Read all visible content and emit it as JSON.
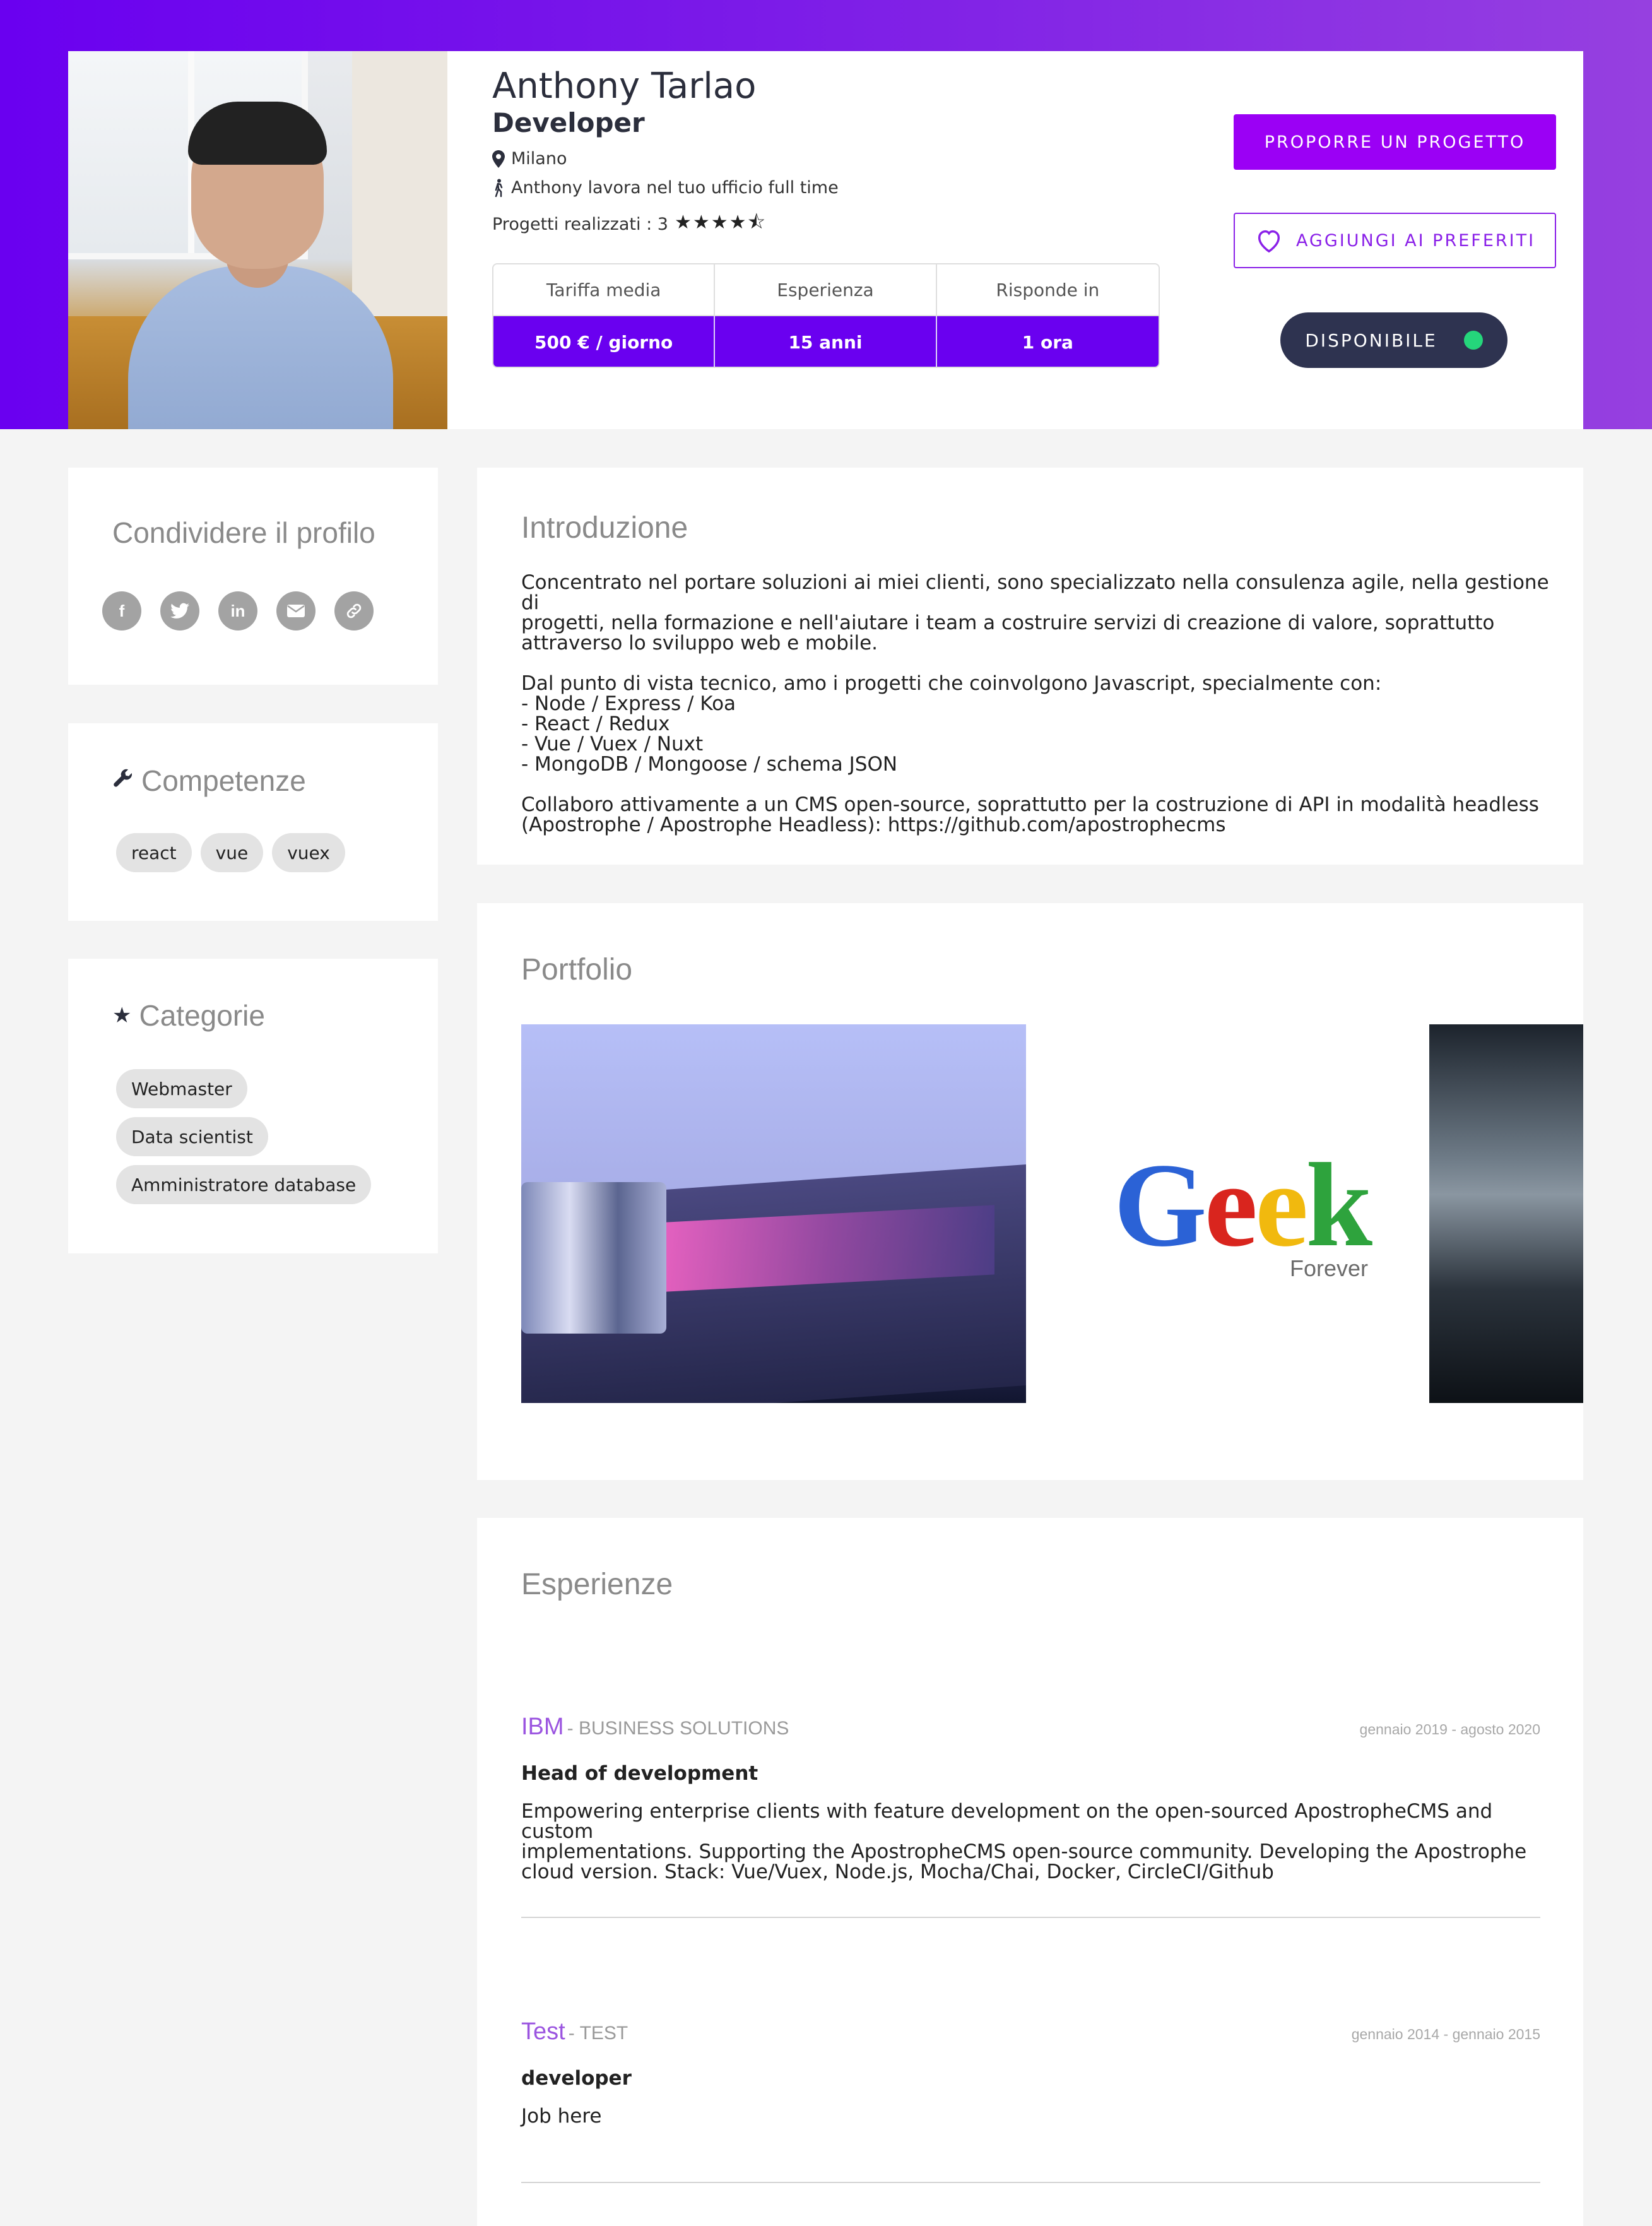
{
  "profile": {
    "name": "Anthony Tarlao",
    "role": "Developer",
    "location": "Milano",
    "office": "Anthony lavora nel tuo ufficio full time",
    "projects_label": "Progetti realizzati : 3",
    "rating_stars": "★★★★⯪",
    "rating": 4.5,
    "stats": {
      "rate_label": "Tariffa media",
      "rate_value": "500 € / giorno",
      "experience_label": "Esperienza",
      "experience_value": "15 anni",
      "response_label": "Risponde in",
      "response_value": "1 ora"
    },
    "actions": {
      "propose": "PROPORRE UN PROGETTO",
      "favorite": "AGGIUNGI AI PREFERITI",
      "availability": "DISPONIBILE"
    }
  },
  "sidebar": {
    "share": {
      "title": "Condividere il profilo",
      "icons": [
        "facebook-icon",
        "twitter-icon",
        "linkedin-icon",
        "email-icon",
        "link-icon"
      ]
    },
    "skills": {
      "title": "Competenze",
      "icon": "wrench-icon",
      "items": [
        "react",
        "vue",
        "vuex"
      ]
    },
    "categories": {
      "title": "Categorie",
      "icon": "star-icon",
      "items": [
        "Webmaster",
        "Data scientist",
        "Amministratore database"
      ]
    }
  },
  "intro": {
    "title": "Introduzione",
    "p1": [
      "Concentrato nel portare soluzioni ai miei clienti, sono specializzato nella consulenza agile, nella gestione di",
      "progetti, nella formazione e nell'aiutare i team a costruire servizi di creazione di valore, soprattutto",
      "attraverso lo sviluppo web e mobile."
    ],
    "p2": [
      "Dal punto di vista tecnico, amo i progetti che coinvolgono Javascript, specialmente con:",
      "- Node / Express / Koa",
      "- React / Redux",
      "- Vue / Vuex / Nuxt",
      "- MongoDB / Mongoose / schema JSON"
    ],
    "p3": [
      "Collaboro attivamente a un CMS open-source, soprattutto per la costruzione di API in modalità headless",
      "(Apostrophe / Apostrophe Headless): https://github.com/apostrophecms"
    ]
  },
  "portfolio": {
    "title": "Portfolio",
    "geek_logo": {
      "text_g": "G",
      "text_e1": "e",
      "text_e2": "e",
      "text_k": "k",
      "sub": "Forever"
    }
  },
  "experiences": {
    "title": "Esperienze",
    "items": [
      {
        "company": "IBM",
        "sector": "- BUSINESS SOLUTIONS",
        "dates": "gennaio 2019 - agosto 2020",
        "position": "Head of development",
        "desc": [
          "Empowering enterprise clients with feature development on the open-sourced ApostropheCMS and custom",
          "implementations. Supporting the ApostropheCMS open-source community. Developing the Apostrophe",
          "cloud version. Stack: Vue/Vuex, Node.js, Mocha/Chai, Docker, CircleCI/Github"
        ]
      },
      {
        "company": "Test",
        "sector": "- TEST",
        "dates": "gennaio 2014 - gennaio 2015",
        "position": "developer",
        "desc": [
          "Job here"
        ]
      }
    ]
  },
  "colors": {
    "brand": "#6a00f0",
    "cta": "#9b00f5",
    "available_dot": "#25d67b",
    "company": "#9b55e0"
  }
}
